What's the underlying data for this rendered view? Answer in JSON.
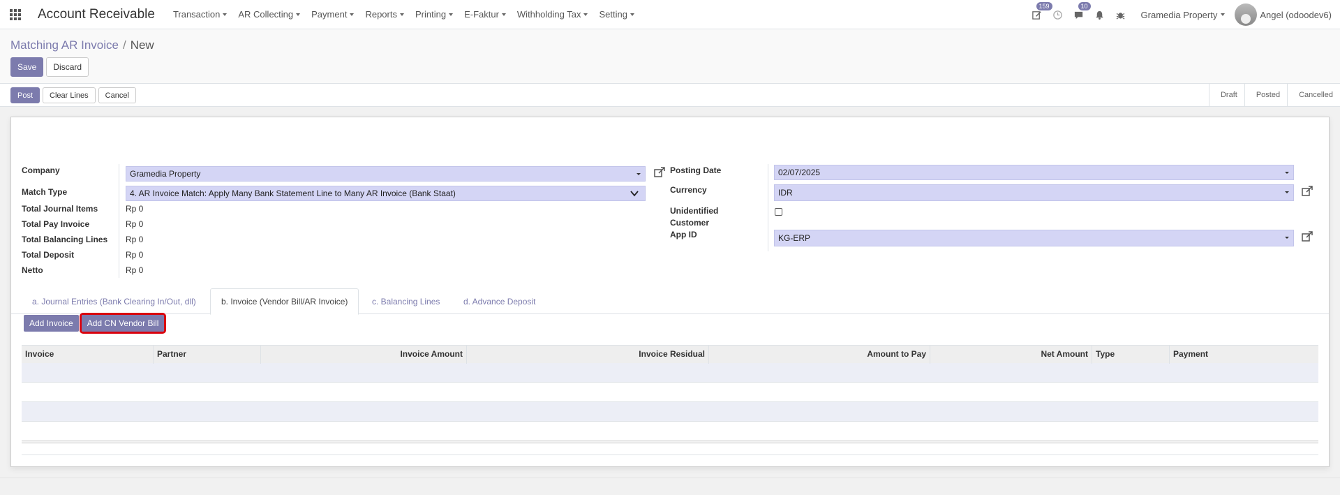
{
  "app": {
    "title": "Account Receivable"
  },
  "nav": {
    "menu": [
      "Transaction",
      "AR Collecting",
      "Payment",
      "Reports",
      "Printing",
      "E-Faktur",
      "Withholding Tax",
      "Setting"
    ],
    "activity_badge": "159",
    "messages_badge": "10",
    "company": "Gramedia Property",
    "user": "Angel (odoodev6)"
  },
  "breadcrumb": {
    "parent": "Matching AR Invoice",
    "separator": "/",
    "current": "New"
  },
  "control": {
    "save": "Save",
    "discard": "Discard"
  },
  "statusbar": {
    "post": "Post",
    "clear_lines": "Clear Lines",
    "cancel": "Cancel",
    "stages": [
      "Draft",
      "Posted",
      "Cancelled"
    ]
  },
  "form": {
    "company_label": "Company",
    "company_value": "Gramedia Property",
    "match_type_label": "Match Type",
    "match_type_value": "4. AR Invoice Match: Apply Many Bank Statement Line to Many AR Invoice (Bank Staat)",
    "total_journal_items_label": "Total Journal Items",
    "total_journal_items_value": "Rp 0",
    "total_pay_invoice_label": "Total Pay Invoice",
    "total_pay_invoice_value": "Rp 0",
    "total_balancing_lines_label": "Total Balancing Lines",
    "total_balancing_lines_value": "Rp 0",
    "total_deposit_label": "Total Deposit",
    "total_deposit_value": "Rp 0",
    "netto_label": "Netto",
    "netto_value": "Rp 0",
    "posting_date_label": "Posting Date",
    "posting_date_value": "02/07/2025",
    "currency_label": "Currency",
    "currency_value": "IDR",
    "unidentified_customer_label_1": "Unidentified",
    "unidentified_customer_label_2": "Customer",
    "unidentified_customer_checked": false,
    "app_id_label": "App ID",
    "app_id_value": "KG-ERP"
  },
  "tabs": [
    {
      "label": "a. Journal Entries (Bank Clearing In/Out, dll)"
    },
    {
      "label": "b. Invoice (Vendor Bill/AR Invoice)"
    },
    {
      "label": "c. Balancing Lines"
    },
    {
      "label": "d. Advance Deposit"
    }
  ],
  "tab_buttons": {
    "add_invoice": "Add Invoice",
    "add_cn_vendor_bill": "Add CN Vendor Bill"
  },
  "table": {
    "columns": [
      "Invoice",
      "Partner",
      "Invoice Amount",
      "Invoice Residual",
      "Amount to Pay",
      "Net Amount",
      "Type",
      "Payment"
    ],
    "rows": []
  },
  "colors": {
    "primary": "#7c7bad",
    "highlight": "#d9000d",
    "input_bg": "#d4d5f5"
  }
}
